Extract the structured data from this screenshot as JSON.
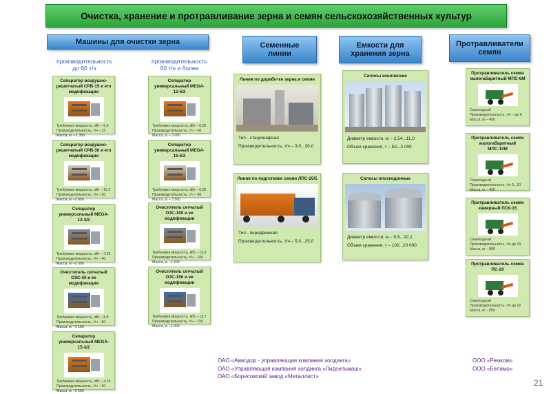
{
  "title": "Очистка, хранение и протравливание зерна и семян сельскохозяйственных культур",
  "headers": {
    "cleaning": "Машины для очистки зерна",
    "seed_lines": "Семенные линии",
    "storage": "Емкости для хранения зерна",
    "treaters": "Протравливатели семян"
  },
  "cleaning_subheads": {
    "col1": "производительность до 60 т/ч",
    "col2": "производительность 60 т/ч и более"
  },
  "cleaning_col1": [
    {
      "title": "Сепаратор воздушно-решетчатый СРВ-15 и его модификации",
      "specs": [
        "Требуемая мощность, кВт – 6,6",
        "Производительность, т/ч – 15",
        "Масса, кг – 1 350"
      ]
    },
    {
      "title": "Сепаратор воздушно-решетчатый СРВ-30 и его модификации",
      "specs": [
        "Требуемая мощность, кВт – 10,2",
        "Производительность, т/ч – 30",
        "Масса, кг –2 850"
      ]
    },
    {
      "title": "Сепаратор универсальный MEGA-12-3/2",
      "specs": [
        "Требуемая мощность, кВт – 4,25",
        "Производительность, т/ч – 40",
        "Масса, кг –2 300"
      ]
    },
    {
      "title": "Очиститель сетчатый ОЗС-50 и ее модификации",
      "specs": [
        "Требуемая мощность, кВт – 8,8",
        "Производительность, т/ч – 50",
        "Масса, кг –1 100"
      ]
    },
    {
      "title": "Сепаратор универсальный MEGA-15-3/2",
      "specs": [
        "Требуемая мощность, кВт – 4,25",
        "Производительность, т/ч – 50",
        "Масса, кг –2 500"
      ]
    }
  ],
  "cleaning_col2": [
    {
      "title": "Сепаратор универсальный MEGA-12-5/2",
      "specs": [
        "Требуемая мощность, кВт – 6,05",
        "Производительность, т/ч – 60",
        "Масса, кг – 3 000"
      ]
    },
    {
      "title": "Сепаратор универсальный MEGA-15-5/2",
      "specs": [
        "Требуемая мощность, кВт – 6,05",
        "Производительность, т/ч – 80",
        "Масса, кг – 3 500"
      ]
    },
    {
      "title": "Очиститель сетчатый ОЗС-100 и ее модификации",
      "specs": [
        "Требуемая мощность, кВт – 12,0",
        "Производительность, т/ч – 100",
        "Масса, кг –1 500"
      ]
    },
    {
      "title": "Очиститель сетчатый ОЗС-150 и ее модификации",
      "specs": [
        "Требуемая мощность, кВт – 13,7",
        "Производительность, т/ч – 150",
        "Масса, кг –1 900"
      ]
    }
  ],
  "seed_lines": [
    {
      "title": "Линия по доработке зерна и семян",
      "specs": [
        "Тип - стационарная",
        "Производительность, т/ч – 3,0...30,0"
      ]
    },
    {
      "title": "Линия по подготовке семян ЛПС-25/5",
      "specs": [
        "Тип - передвижная",
        "Производительность, т/ч – 5,0...25,0"
      ]
    }
  ],
  "storage": [
    {
      "title": "Силосы конические",
      "specs": [
        "Диаметр емкости, м – 2,54...11,0",
        "Объем хранения, т – 50...3 000"
      ]
    },
    {
      "title": "Силосы плоскодонные",
      "specs": [
        "Диаметр емкости, м – 5,5...32,1",
        "Объем хранения, т – 100...20 000"
      ]
    }
  ],
  "treaters": [
    {
      "title": "Протравливатель семян малогабаритный МПС-6М",
      "specs": [
        "Самоходный",
        "Производительность, т/ч – до 6",
        "Масса, кг – 450"
      ]
    },
    {
      "title": "Протравливатель семян малогабаритный МПС-10М",
      "specs": [
        "Самоходный",
        "Производительность, т/ч 3...10",
        "Масса, кг – 450"
      ]
    },
    {
      "title": "Протравливатель семян камерный ПСК-15",
      "specs": [
        "Самоходный",
        "Производительность, т/ч до 20",
        "Масса, кг – 800"
      ]
    },
    {
      "title": "Протравливатель семян ПС-20",
      "specs": [
        "Самоходный",
        "Производительность, т/ч до 22",
        "Масса, кг – 850"
      ]
    }
  ],
  "companies_left": [
    "ОАО «Амкодор - управляющая компания холдинга»",
    "ОАО «Управляющая компания холдинга «Лидсельмаш»",
    "ОАО «Борисовский завод «Металлист»"
  ],
  "companies_right": [
    "ООО «Ремком»",
    "ООО «Беламо»"
  ],
  "page_number": "21",
  "colors": {
    "title_green": "#2ea33b",
    "header_blue": "#3a86cc",
    "card_green": "#cfe9b0",
    "company_purple": "#5a1d8c"
  }
}
